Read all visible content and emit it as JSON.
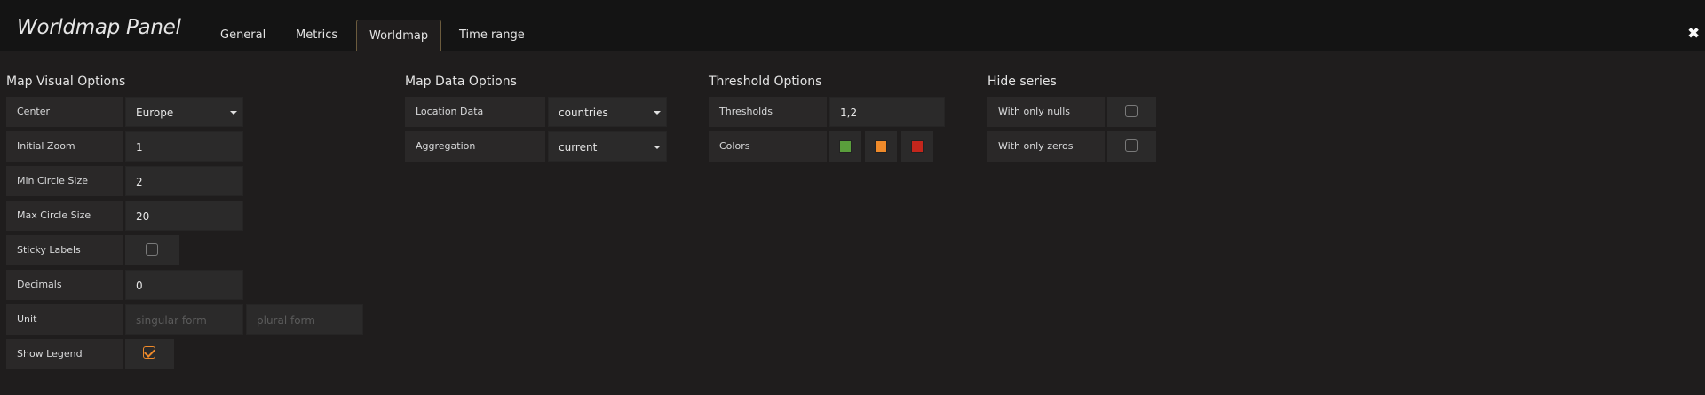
{
  "header": {
    "title": "Worldmap Panel",
    "tabs": [
      "General",
      "Metrics",
      "Worldmap",
      "Time range"
    ],
    "active_tab": "Worldmap",
    "close_glyph": "✖"
  },
  "map_visual": {
    "title": "Map Visual Options",
    "center_label": "Center",
    "center_value": "Europe",
    "initial_zoom_label": "Initial Zoom",
    "initial_zoom_value": "1",
    "min_circle_label": "Min Circle Size",
    "min_circle_value": "2",
    "max_circle_label": "Max Circle Size",
    "max_circle_value": "20",
    "sticky_labels_label": "Sticky Labels",
    "sticky_labels_checked": false,
    "decimals_label": "Decimals",
    "decimals_value": "0",
    "unit_label": "Unit",
    "unit_singular_placeholder": "singular form",
    "unit_plural_placeholder": "plural form",
    "show_legend_label": "Show Legend",
    "show_legend_checked": true
  },
  "map_data": {
    "title": "Map Data Options",
    "location_label": "Location Data",
    "location_value": "countries",
    "aggregation_label": "Aggregation",
    "aggregation_value": "current"
  },
  "threshold": {
    "title": "Threshold Options",
    "thresholds_label": "Thresholds",
    "thresholds_value": "1,2",
    "colors_label": "Colors",
    "colors": [
      "#5a9e3c",
      "#ef8a2a",
      "#c3261c"
    ]
  },
  "hide_series": {
    "title": "Hide series",
    "nulls_label": "With only nulls",
    "nulls_checked": false,
    "zeros_label": "With only zeros",
    "zeros_checked": false
  },
  "icons": {
    "close": "close-icon",
    "dropdown": "chevron-down-icon",
    "checkbox": "checkbox-icon"
  },
  "theme": {
    "background": "#1f1d1d",
    "header": "#141414",
    "accent": "#ef8a2a"
  }
}
